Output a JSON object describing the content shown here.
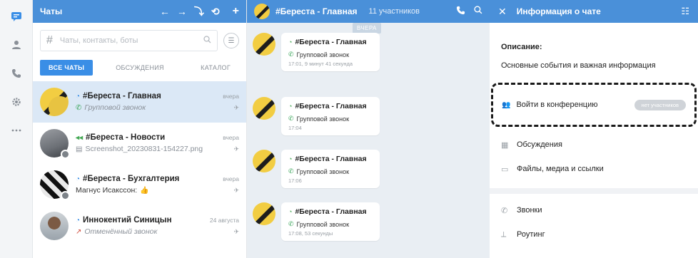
{
  "rail": {
    "icons": [
      "chat-icon",
      "contacts-icon",
      "phone-icon",
      "settings-icon",
      "more-icon"
    ]
  },
  "chats_panel": {
    "title": "Чаты",
    "search_placeholder": "Чаты, контакты, боты",
    "tabs": [
      {
        "label": "ВСЕ ЧАТЫ",
        "active": true
      },
      {
        "label": "ОБСУЖДЕНИЯ",
        "active": false
      },
      {
        "label": "КАТАЛОГ",
        "active": false
      }
    ],
    "items": [
      {
        "name": "#Береста - Главная",
        "sub": "Групповой звонок",
        "date": "вчера"
      },
      {
        "name": "#Береста - Новости",
        "sub": "Screenshot_20230831-154227.png",
        "date": "вчера"
      },
      {
        "name": "#Береста - Бухгалтерия",
        "sub": "Магнус Исакссон:",
        "date": "вчера"
      },
      {
        "name": "Иннокентий Синицын",
        "sub": "Отменённый звонок",
        "date": "24 августа"
      }
    ]
  },
  "conversation": {
    "title": "#Береста - Главная",
    "participants": "11 участников",
    "day_label": "ВЧЕРА",
    "messages": [
      {
        "title": "#Береста - Главная",
        "call": "Групповой звонок",
        "time": "17:01, 9 минут 41 секунда"
      },
      {
        "title": "#Береста - Главная",
        "call": "Групповой звонок",
        "time": "17:04"
      },
      {
        "title": "#Береста - Главная",
        "call": "Групповой звонок",
        "time": "17:06"
      },
      {
        "title": "#Береста - Главная",
        "call": "Групповой звонок",
        "time": "17:08, 53 секунды"
      }
    ]
  },
  "info_panel": {
    "title": "Информация о чате",
    "description_label": "Описание:",
    "description_text": "Основные события и важная информация",
    "join_conference": "Войти в конференцию",
    "no_participants": "нет участников",
    "discussions": "Обсуждения",
    "files": "Файлы, медиа и ссылки",
    "calls": "Звонки",
    "routing": "Роутинг"
  },
  "colors": {
    "header_blue": "#4a90d9",
    "accent": "#3a8ee6",
    "selected_bg": "#dbe8f6"
  }
}
